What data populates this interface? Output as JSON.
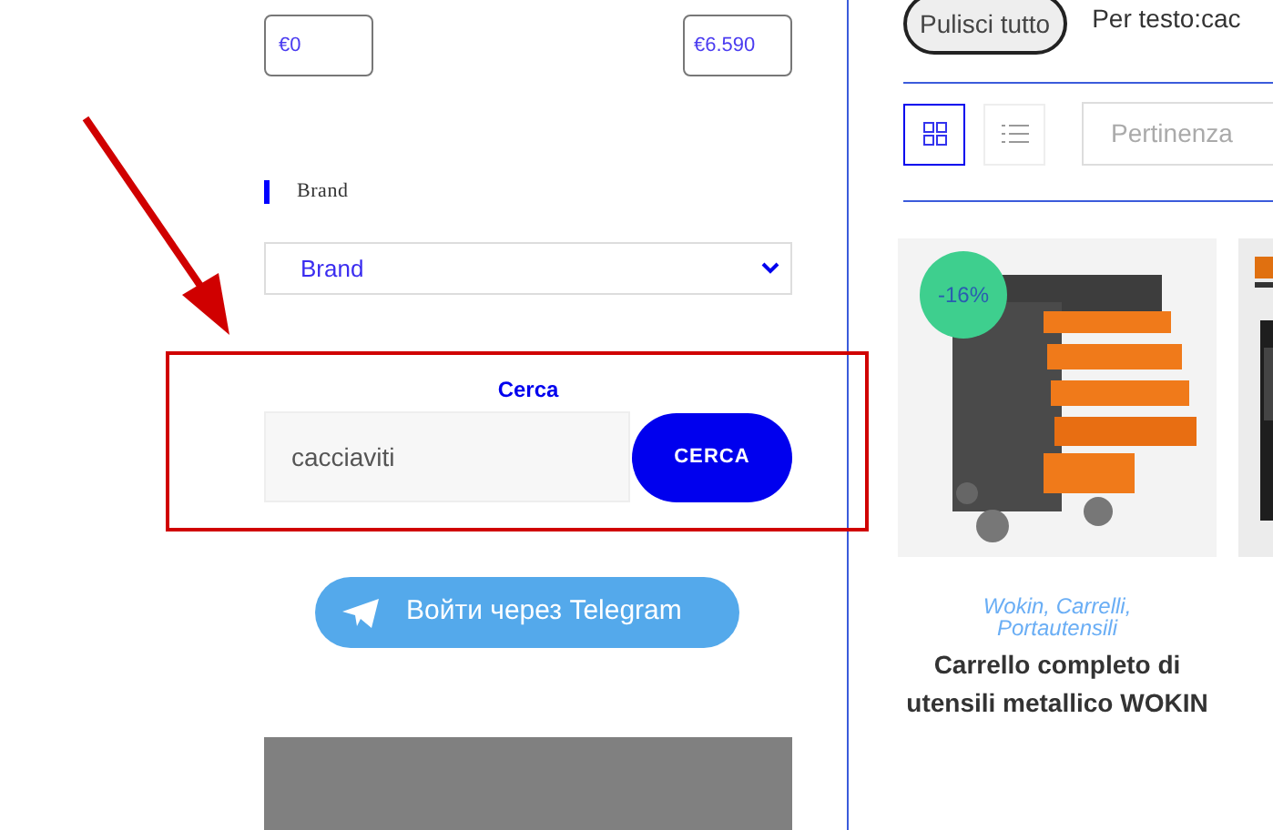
{
  "price_range": {
    "min": "€0",
    "max": "€6.590"
  },
  "brand_filter": {
    "heading": "Brand",
    "select_value": "Brand"
  },
  "search": {
    "heading": "Cerca",
    "value": "cacciaviti",
    "button": "CERCA"
  },
  "telegram_button": "Войти через Telegram",
  "toolbar": {
    "clear_button": "Pulisci tutto",
    "active_filter": "Per testo:cac",
    "views": [
      {
        "kind": "grid",
        "selected": true
      },
      {
        "kind": "list",
        "selected": false
      }
    ],
    "sort_placeholder": "Pertinenza"
  },
  "products": [
    {
      "discount": "-16%",
      "categories": "Wokin, Carrelli, Portautensili",
      "title": "Carrello completo di utensili metallico WOKIN"
    },
    {
      "kind": "picture"
    }
  ]
}
